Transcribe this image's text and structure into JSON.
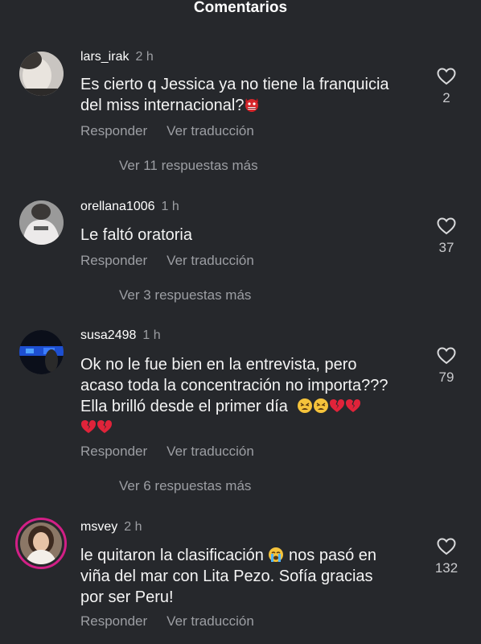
{
  "header": {
    "title": "Comentarios"
  },
  "comments": [
    {
      "username": "lars_irak",
      "time": "2 h",
      "text_line1": "Es cierto q Jessica ya no tiene la franquicia",
      "text_line2": "del miss internacional?",
      "likes": "2",
      "reply": "Responder",
      "translate": "Ver traducción",
      "more": "Ver 11 respuestas más"
    },
    {
      "username": "orellana1006",
      "time": "1 h",
      "text_line1": "Le faltó oratoria",
      "likes": "37",
      "reply": "Responder",
      "translate": "Ver traducción",
      "more": "Ver 3 respuestas más"
    },
    {
      "username": "susa2498",
      "time": "1 h",
      "text_line1": "Ok no le fue bien en la entrevista, pero",
      "text_line2": "acaso toda la concentración no importa???",
      "text_line3": "Ella brilló desde el primer día",
      "likes": "79",
      "reply": "Responder",
      "translate": "Ver traducción",
      "more": "Ver 6 respuestas más"
    },
    {
      "username": "msvey",
      "time": "2 h",
      "text_line1a": "le quitaron la clasificación",
      "text_line1b": "nos pasó en",
      "text_line2": "viña del mar con Lita Pezo. Sofía gracias",
      "text_line3": "por ser Peru!",
      "likes": "132",
      "reply": "Responder",
      "translate": "Ver traducción"
    }
  ],
  "colors": {
    "background": "#26282c",
    "secondary_text": "#9c9ea3",
    "story_ring": "#d21f86",
    "broken_heart": "#e0233a"
  },
  "icons": [
    "heart-outline-icon",
    "ogre-emoji",
    "tired-face-emoji",
    "broken-heart-emoji",
    "crying-face-emoji"
  ]
}
